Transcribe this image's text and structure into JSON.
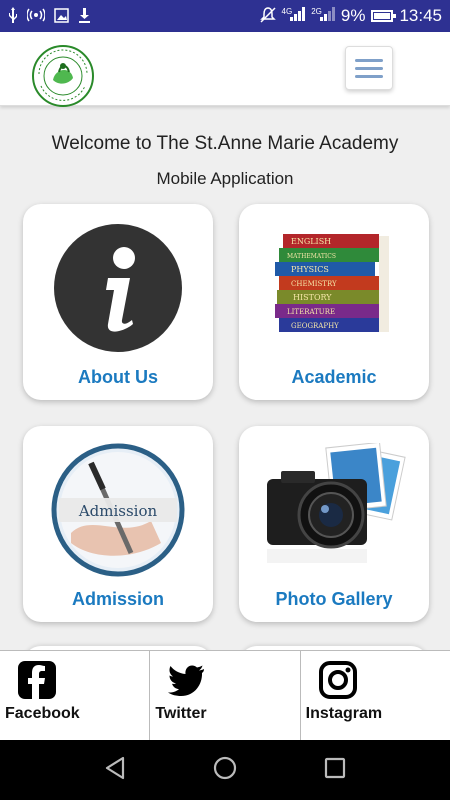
{
  "status_bar": {
    "time": "13:45",
    "battery_percent": "9%",
    "network_1": "4G",
    "network_2": "2G",
    "left_icons": [
      "usb-icon",
      "hotspot-icon",
      "image-icon",
      "download-icon"
    ],
    "right_icons": [
      "mute-icon",
      "signal-icon",
      "signal-icon",
      "battery-charging-icon"
    ]
  },
  "header": {
    "logo_alt": "St. Anne Marie Academy logo",
    "menu_icon": "hamburger-menu-icon"
  },
  "welcome": {
    "line1": "Welcome to The St.Anne Marie Academy",
    "line2": "Mobile Application"
  },
  "cards": [
    {
      "label": "About Us",
      "icon": "info-icon"
    },
    {
      "label": "Academic",
      "icon": "books-icon"
    },
    {
      "label": "Admission",
      "icon": "admission-icon"
    },
    {
      "label": "Photo Gallery",
      "icon": "camera-icon"
    }
  ],
  "social": [
    {
      "label": "Facebook",
      "icon": "facebook-icon"
    },
    {
      "label": "Twitter",
      "icon": "twitter-icon"
    },
    {
      "label": "Instagram",
      "icon": "instagram-icon"
    }
  ],
  "colors": {
    "status_bar": "#2e3192",
    "card_label": "#1b7ac0",
    "background": "#efefef"
  }
}
